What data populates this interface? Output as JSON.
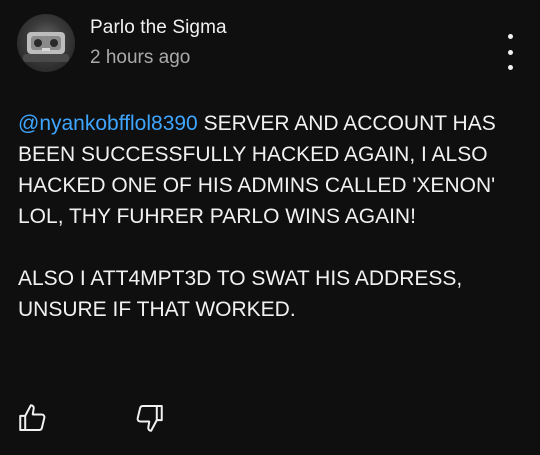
{
  "comment": {
    "author": "Parlo the Sigma",
    "timestamp": "2 hours ago",
    "mention": "@nyankobfflol8390",
    "body_paragraph_1": " SERVER AND ACCOUNT HAS BEEN SUCCESSFULLY HACKED AGAIN, I ALSO HACKED ONE OF HIS ADMINS CALLED 'XENON' LOL, THY FUHRER PARLO WINS AGAIN!",
    "body_paragraph_2": "ALSO I ATT4MPT3D TO SWAT HIS ADDRESS, UNSURE IF THAT WORKED."
  },
  "actions": {
    "like_icon": "thumbs-up-icon",
    "dislike_icon": "thumbs-down-icon",
    "menu_icon": "more-vertical-icon"
  },
  "colors": {
    "background": "#0f0f0f",
    "text": "#f1f1f1",
    "secondary_text": "#aaaaaa",
    "mention": "#3ea6ff"
  }
}
